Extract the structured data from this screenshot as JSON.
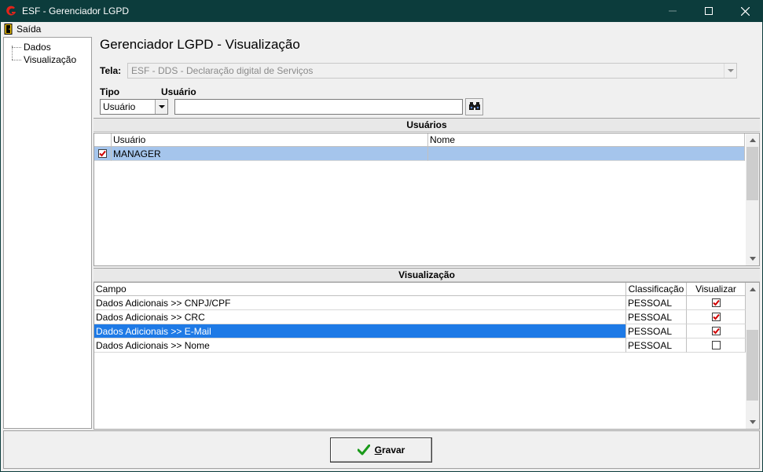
{
  "window": {
    "title": "ESF - Gerenciador LGPD"
  },
  "menu": {
    "items": [
      {
        "label": "Saída",
        "icon": "exit-door-icon"
      }
    ]
  },
  "tree": {
    "items": [
      {
        "label": "Dados"
      },
      {
        "label": "Visualização"
      }
    ]
  },
  "page": {
    "title": "Gerenciador LGPD - Visualização"
  },
  "form": {
    "tela_label": "Tela:",
    "tela_value": "ESF - DDS - Declaração digital de Serviços",
    "tipo_label": "Tipo",
    "tipo_value": "Usuário",
    "usuario_label": "Usuário",
    "usuario_value": ""
  },
  "usuarios_panel": {
    "header": "Usuários",
    "columns": [
      "Usuário",
      "Nome"
    ],
    "rows": [
      {
        "checked": true,
        "usuario": "MANAGER",
        "nome": ""
      }
    ]
  },
  "visualizacao_panel": {
    "header": "Visualização",
    "columns": [
      "Campo",
      "Classificação",
      "Visualizar"
    ],
    "rows": [
      {
        "campo": "Dados Adicionais >> CNPJ/CPF",
        "classificacao": "PESSOAL",
        "visualizar": true
      },
      {
        "campo": "Dados Adicionais >> CRC",
        "classificacao": "PESSOAL",
        "visualizar": true
      },
      {
        "campo": "Dados Adicionais >> E-Mail",
        "classificacao": "PESSOAL",
        "visualizar": true
      },
      {
        "campo": "Dados Adicionais >> Nome",
        "classificacao": "PESSOAL",
        "visualizar": false
      }
    ]
  },
  "actions": {
    "gravar_prefix": "G",
    "gravar_rest": "ravar"
  },
  "colors": {
    "titlebar": "#0c3c3c",
    "selection_light": "#a5c5ec",
    "selection_blue": "#1e7ae6",
    "check_red": "#d00000",
    "gravar_check": "#1a9a1a"
  }
}
